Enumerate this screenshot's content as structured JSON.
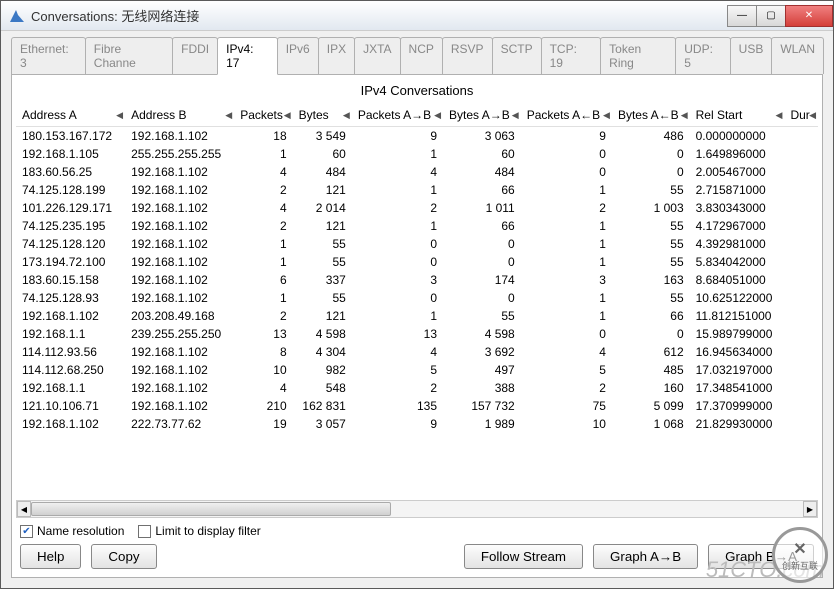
{
  "window": {
    "title": "Conversations: 无线网络连接"
  },
  "tabs": [
    {
      "label": "Ethernet: 3",
      "active": false
    },
    {
      "label": "Fibre Channe",
      "active": false
    },
    {
      "label": "FDDI",
      "active": false
    },
    {
      "label": "IPv4: 17",
      "active": true
    },
    {
      "label": "IPv6",
      "active": false
    },
    {
      "label": "IPX",
      "active": false
    },
    {
      "label": "JXTA",
      "active": false
    },
    {
      "label": "NCP",
      "active": false
    },
    {
      "label": "RSVP",
      "active": false
    },
    {
      "label": "SCTP",
      "active": false
    },
    {
      "label": "TCP: 19",
      "active": false
    },
    {
      "label": "Token Ring",
      "active": false
    },
    {
      "label": "UDP: 5",
      "active": false
    },
    {
      "label": "USB",
      "active": false
    },
    {
      "label": "WLAN",
      "active": false
    }
  ],
  "panel": {
    "title": "IPv4 Conversations"
  },
  "columns": [
    "Address A",
    "Address B",
    "Packets",
    "Bytes",
    "Packets A→B",
    "Bytes A→B",
    "Packets A←B",
    "Bytes A←B",
    "Rel Start",
    "Dur"
  ],
  "rows": [
    {
      "a": "180.153.167.172",
      "b": "192.168.1.102",
      "p": "18",
      "bt": "3 549",
      "pab": "9",
      "bab": "3 063",
      "pba": "9",
      "bba": "486",
      "rs": "0.000000000"
    },
    {
      "a": "192.168.1.105",
      "b": "255.255.255.255",
      "p": "1",
      "bt": "60",
      "pab": "1",
      "bab": "60",
      "pba": "0",
      "bba": "0",
      "rs": "1.649896000"
    },
    {
      "a": "183.60.56.25",
      "b": "192.168.1.102",
      "p": "4",
      "bt": "484",
      "pab": "4",
      "bab": "484",
      "pba": "0",
      "bba": "0",
      "rs": "2.005467000"
    },
    {
      "a": "74.125.128.199",
      "b": "192.168.1.102",
      "p": "2",
      "bt": "121",
      "pab": "1",
      "bab": "66",
      "pba": "1",
      "bba": "55",
      "rs": "2.715871000"
    },
    {
      "a": "101.226.129.171",
      "b": "192.168.1.102",
      "p": "4",
      "bt": "2 014",
      "pab": "2",
      "bab": "1 011",
      "pba": "2",
      "bba": "1 003",
      "rs": "3.830343000"
    },
    {
      "a": "74.125.235.195",
      "b": "192.168.1.102",
      "p": "2",
      "bt": "121",
      "pab": "1",
      "bab": "66",
      "pba": "1",
      "bba": "55",
      "rs": "4.172967000"
    },
    {
      "a": "74.125.128.120",
      "b": "192.168.1.102",
      "p": "1",
      "bt": "55",
      "pab": "0",
      "bab": "0",
      "pba": "1",
      "bba": "55",
      "rs": "4.392981000"
    },
    {
      "a": "173.194.72.100",
      "b": "192.168.1.102",
      "p": "1",
      "bt": "55",
      "pab": "0",
      "bab": "0",
      "pba": "1",
      "bba": "55",
      "rs": "5.834042000"
    },
    {
      "a": "183.60.15.158",
      "b": "192.168.1.102",
      "p": "6",
      "bt": "337",
      "pab": "3",
      "bab": "174",
      "pba": "3",
      "bba": "163",
      "rs": "8.684051000"
    },
    {
      "a": "74.125.128.93",
      "b": "192.168.1.102",
      "p": "1",
      "bt": "55",
      "pab": "0",
      "bab": "0",
      "pba": "1",
      "bba": "55",
      "rs": "10.625122000"
    },
    {
      "a": "192.168.1.102",
      "b": "203.208.49.168",
      "p": "2",
      "bt": "121",
      "pab": "1",
      "bab": "55",
      "pba": "1",
      "bba": "66",
      "rs": "11.812151000"
    },
    {
      "a": "192.168.1.1",
      "b": "239.255.255.250",
      "p": "13",
      "bt": "4 598",
      "pab": "13",
      "bab": "4 598",
      "pba": "0",
      "bba": "0",
      "rs": "15.989799000"
    },
    {
      "a": "114.112.93.56",
      "b": "192.168.1.102",
      "p": "8",
      "bt": "4 304",
      "pab": "4",
      "bab": "3 692",
      "pba": "4",
      "bba": "612",
      "rs": "16.945634000"
    },
    {
      "a": "114.112.68.250",
      "b": "192.168.1.102",
      "p": "10",
      "bt": "982",
      "pab": "5",
      "bab": "497",
      "pba": "5",
      "bba": "485",
      "rs": "17.032197000"
    },
    {
      "a": "192.168.1.1",
      "b": "192.168.1.102",
      "p": "4",
      "bt": "548",
      "pab": "2",
      "bab": "388",
      "pba": "2",
      "bba": "160",
      "rs": "17.348541000"
    },
    {
      "a": "121.10.106.71",
      "b": "192.168.1.102",
      "p": "210",
      "bt": "162 831",
      "pab": "135",
      "bab": "157 732",
      "pba": "75",
      "bba": "5 099",
      "rs": "17.370999000"
    },
    {
      "a": "192.168.1.102",
      "b": "222.73.77.62",
      "p": "19",
      "bt": "3 057",
      "pab": "9",
      "bab": "1 989",
      "pba": "10",
      "bba": "1 068",
      "rs": "21.829930000"
    }
  ],
  "options": {
    "name_resolution": {
      "label": "Name resolution",
      "checked": true
    },
    "display_filter": {
      "label": "Limit to display filter",
      "checked": false
    }
  },
  "buttons": {
    "help": "Help",
    "copy": "Copy",
    "follow": "Follow Stream",
    "graph_ab": "Graph A→B",
    "graph_ba": "Graph B→A"
  },
  "watermark": "51CTO.com",
  "logo": "创新互联"
}
